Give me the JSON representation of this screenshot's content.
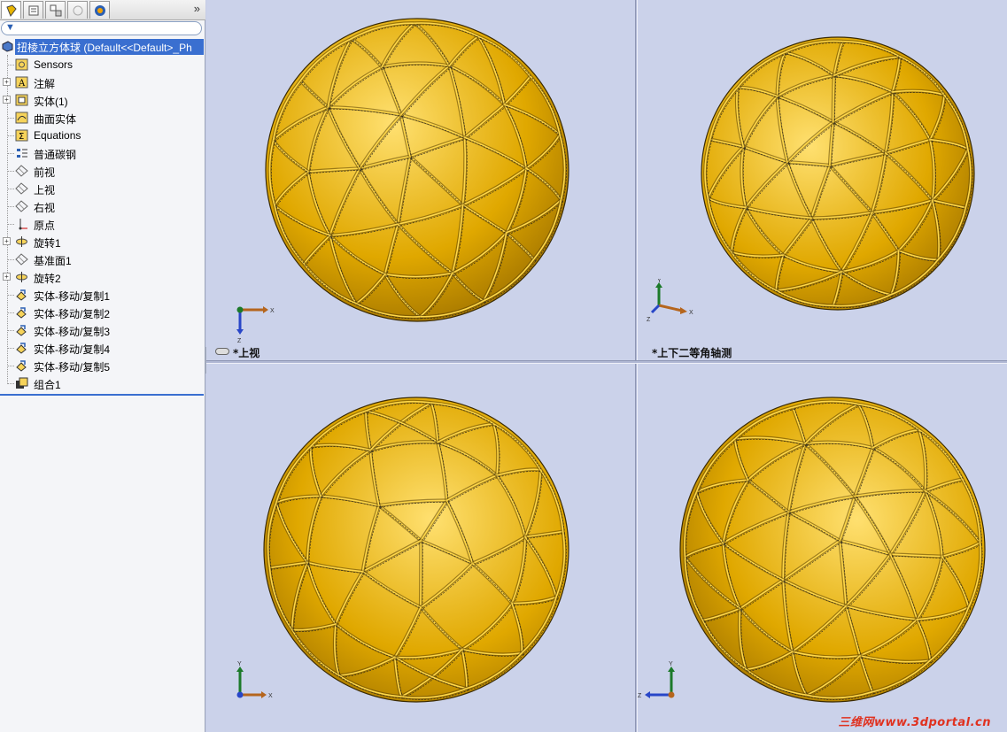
{
  "tabs": {
    "icons": [
      "feature-manager-icon",
      "property-manager-icon",
      "configuration-manager-icon",
      "dimxpert-icon",
      "display-manager-icon"
    ],
    "expand_label": "»"
  },
  "filter": {
    "placeholder": ""
  },
  "tree": {
    "root_label": "扭棱立方体球  (Default<<Default>_Ph",
    "items": [
      {
        "label": "Sensors",
        "icon": "sensors-icon",
        "expandable": false
      },
      {
        "label": "注解",
        "icon": "annotations-icon",
        "expandable": true
      },
      {
        "label": "实体(1)",
        "icon": "solid-bodies-icon",
        "expandable": true
      },
      {
        "label": "曲面实体",
        "icon": "surface-bodies-icon",
        "expandable": false
      },
      {
        "label": "Equations",
        "icon": "equations-icon",
        "expandable": false
      },
      {
        "label": "普通碳钢",
        "icon": "material-icon",
        "expandable": false
      },
      {
        "label": "前视",
        "icon": "plane-icon",
        "expandable": false
      },
      {
        "label": "上视",
        "icon": "plane-icon",
        "expandable": false
      },
      {
        "label": "右视",
        "icon": "plane-icon",
        "expandable": false
      },
      {
        "label": "原点",
        "icon": "origin-icon",
        "expandable": false
      },
      {
        "label": "旋转1",
        "icon": "revolve-icon",
        "expandable": true
      },
      {
        "label": "基准面1",
        "icon": "plane-icon",
        "expandable": false
      },
      {
        "label": "旋转2",
        "icon": "revolve-icon",
        "expandable": true
      },
      {
        "label": "实体-移动/复制1",
        "icon": "move-copy-icon",
        "expandable": false
      },
      {
        "label": "实体-移动/复制2",
        "icon": "move-copy-icon",
        "expandable": false
      },
      {
        "label": "实体-移动/复制3",
        "icon": "move-copy-icon",
        "expandable": false
      },
      {
        "label": "实体-移动/复制4",
        "icon": "move-copy-icon",
        "expandable": false
      },
      {
        "label": "实体-移动/复制5",
        "icon": "move-copy-icon",
        "expandable": false
      },
      {
        "label": "组合1",
        "icon": "combine-icon",
        "expandable": false
      }
    ]
  },
  "viewports": {
    "top_left": {
      "label": "*上视",
      "triad": {
        "axis1": "X",
        "axis2": "Z"
      }
    },
    "top_right": {
      "label": "*上下二等角轴测",
      "triad": {
        "axis1": "Y",
        "axis2": "X",
        "axis3": "Z"
      }
    },
    "bottom_left": {
      "label": "",
      "triad": {
        "axis1": "Y",
        "axis2": "X"
      }
    },
    "bottom_right": {
      "label": "",
      "triad": {
        "axis1": "Y",
        "axis2": "Z"
      }
    }
  },
  "watermark": "三维网www.3dportal.cn",
  "colors": {
    "sphere_light": "#ffe070",
    "sphere_mid": "#e0a800",
    "sphere_dark": "#8a6000",
    "selection": "#3a6fd0",
    "viewport_bg": "#cbd2ea",
    "watermark": "#e0311f"
  }
}
